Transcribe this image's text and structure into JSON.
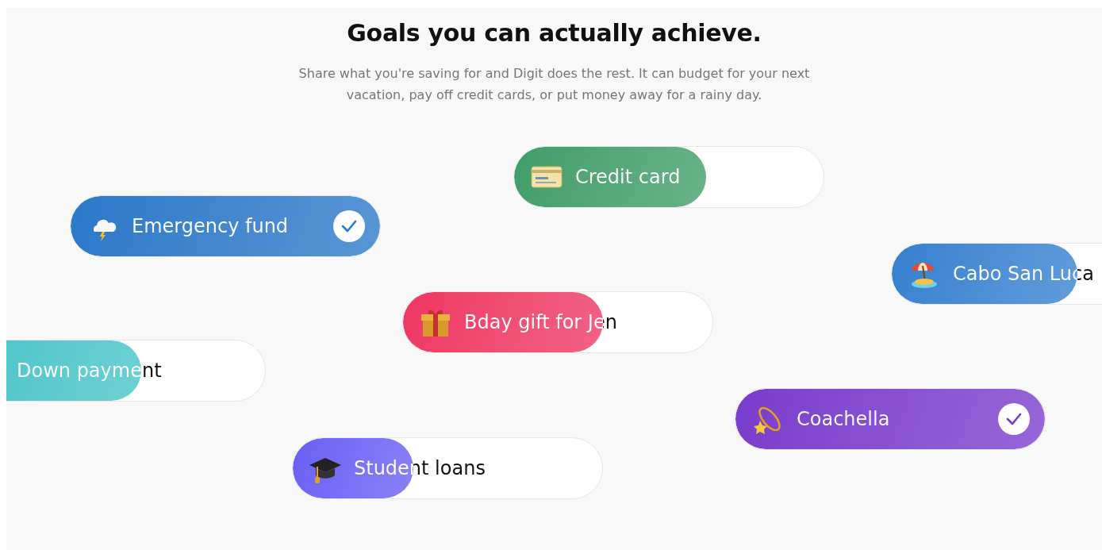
{
  "heading": "Goals you can actually achieve.",
  "intro": "Share what you're saving for and Digit does the rest. It can budget for your next vacation, pay off credit cards, or put money away for a rainy day.",
  "goals": [
    {
      "label": "Credit card",
      "level": 0.62,
      "checked": false,
      "color": "#3f9d68"
    },
    {
      "label": "Emergency fund",
      "level": 1,
      "checked": true,
      "color": "#2a78c8"
    },
    {
      "label": "Cabo San Luca",
      "level": 0.6,
      "checked": false,
      "color": "#3580d0"
    },
    {
      "label": "Bday gift for Jen",
      "level": 0.645,
      "checked": false,
      "color": "#ee3563"
    },
    {
      "label": "Down payment",
      "level": 0.6,
      "checked": false,
      "color": "#45c3c8"
    },
    {
      "label": "Coachella",
      "level": 1,
      "checked": true,
      "color": "#7a3bcc"
    },
    {
      "label": "Student loans",
      "level": 0.39,
      "checked": false,
      "color": "#6a5ef4"
    }
  ]
}
